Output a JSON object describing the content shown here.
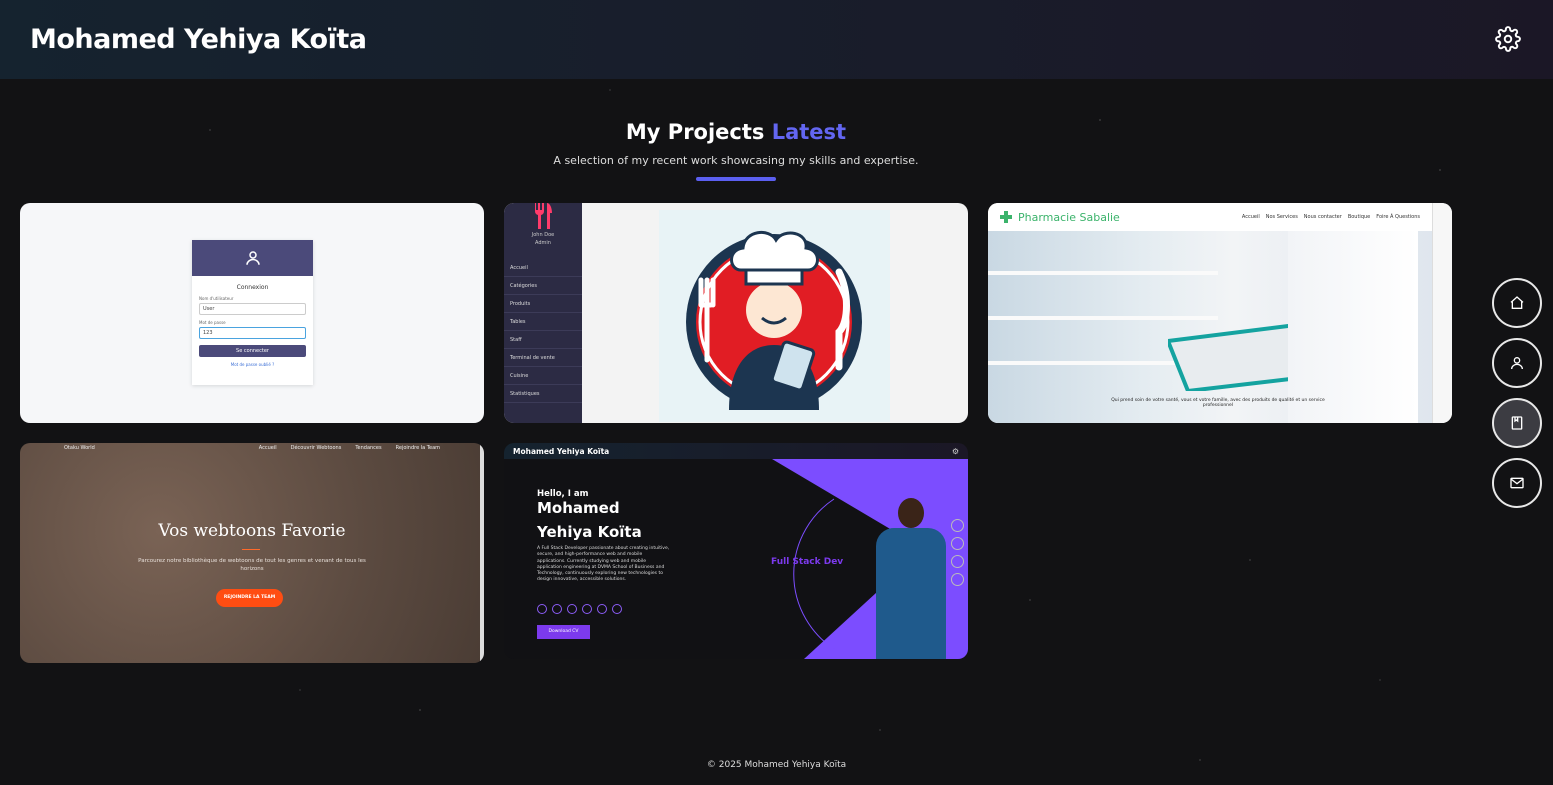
{
  "header": {
    "brand": "Mohamed Yehiya Koïta"
  },
  "section": {
    "title_main": "My Projects",
    "title_accent": "Latest",
    "subtitle": "A selection of my recent work showcasing my skills and expertise."
  },
  "projects": [
    {
      "login": {
        "title": "Connexion",
        "user_label": "Nom d'utilisateur",
        "user_value": "User",
        "pass_label": "Mot de passe",
        "pass_value": "123",
        "button": "Se connecter",
        "link": "Mot de passe oublié ?"
      }
    },
    {
      "admin": {
        "user_name": "John Doe",
        "user_role": "Admin",
        "menu": [
          "Accueil",
          "Catégories",
          "Produits",
          "Tables",
          "Staff",
          "Terminal de vente",
          "Cuisine",
          "Statistiques"
        ]
      }
    },
    {
      "pharmacy": {
        "brand": "Pharmacie Sabalie",
        "nav": [
          "Accueil",
          "Nos Services",
          "Nous contacter",
          "Boutique",
          "Foire Á Questions"
        ],
        "hero_text": "Qui prend soin de votre santé, vous et votre famille, avec des produits de qualité et un service professionnel"
      }
    },
    {
      "webtoon": {
        "brand": "Otaku World",
        "nav": [
          "Accueil",
          "Découvrir Webtoons",
          "Tendances",
          "Rejoindre la Team"
        ],
        "title": "Vos webtoons Favorie",
        "subtitle": "Parcourez notre bibliothèque de webtoons de tout les genres et venant de tous les horizons",
        "button": "REJOINDRE LA TEAM"
      }
    },
    {
      "portfolio": {
        "brand": "Mohamed Yehiya Koïta",
        "hello": "Hello, I am",
        "name_line1": "Mohamed",
        "name_line2": "Yehiya Koïta",
        "description": "A Full Stack Developer passionate about creating intuitive, secure, and high-performance web and mobile applications. Currently studying web and mobile application engineering at DVMA School of Business and Technology, continuously exploring new technologies to design innovative, accessible solutions.",
        "role": "Full Stack Dev",
        "cv_button": "Download CV"
      }
    }
  ],
  "right_nav": [
    "home-icon",
    "user-icon",
    "book-icon",
    "mail-icon"
  ],
  "footer": {
    "text": "© 2025 Mohamed Yehiya Koïta"
  },
  "colors": {
    "accent": "#6366f1",
    "purple": "#7c3aed",
    "orange": "#ff4d12",
    "green": "#3bb36b"
  }
}
